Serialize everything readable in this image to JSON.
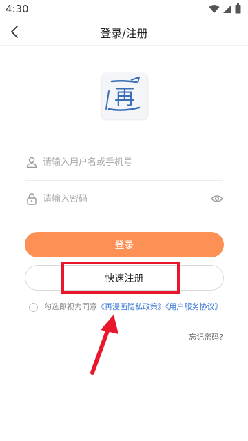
{
  "status_bar": {
    "time": "4:30"
  },
  "nav": {
    "title": "登录/注册"
  },
  "logo": {
    "glyph": "再"
  },
  "form": {
    "username_placeholder": "请输入用户名或手机号",
    "password_placeholder": "请输入密码"
  },
  "buttons": {
    "login_label": "登录",
    "register_label": "快速注册"
  },
  "agreement": {
    "prefix": "勾选即视为同意",
    "privacy_link": "《再漫画隐私政策》",
    "terms_link": "《用户服务协议》"
  },
  "forgot_password": "忘记密码?",
  "colors": {
    "accent": "#fd9155",
    "link": "#3a78d6",
    "highlight": "#e8172b"
  }
}
